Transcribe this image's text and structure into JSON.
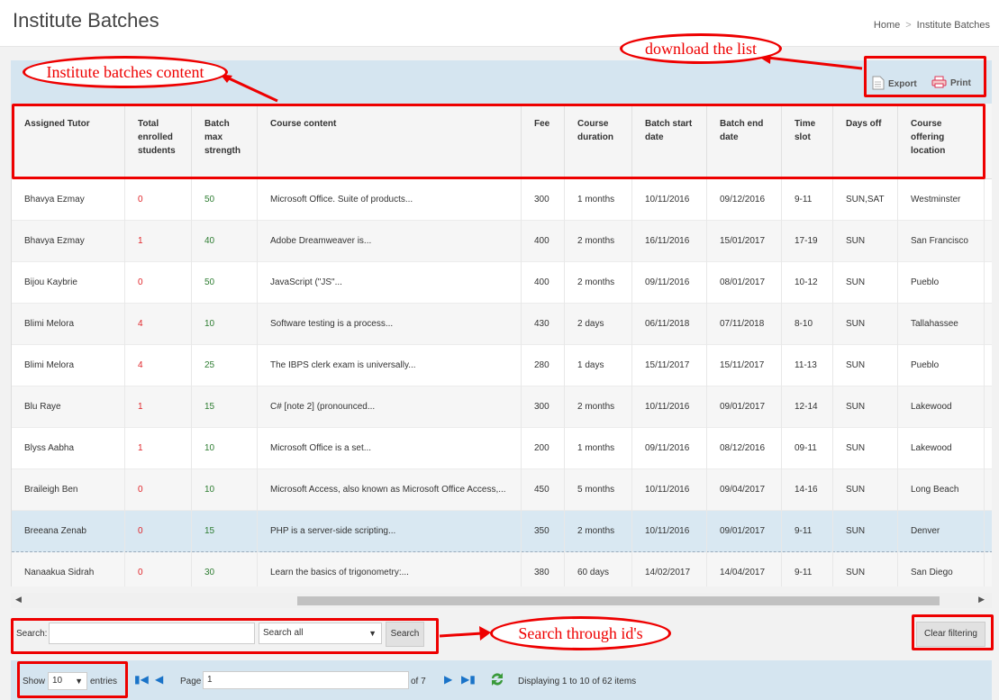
{
  "header": {
    "title": "Institute Batches",
    "breadcrumb_home": "Home",
    "breadcrumb_current": "Institute Batches"
  },
  "toolbar": {
    "export_label": "Export",
    "print_label": "Print"
  },
  "columns": [
    "Assigned Tutor",
    "Total enrolled students",
    "Batch max strength",
    "Course content",
    "Fee",
    "Course duration",
    "Batch start date",
    "Batch end date",
    "Time slot",
    "Days off",
    "Course offering location"
  ],
  "rows": [
    [
      "Bhavya Ezmay",
      "0",
      "50",
      "Microsoft Office. Suite of products...",
      "300",
      "1 months",
      "10/11/2016",
      "09/12/2016",
      "9-11",
      "SUN,SAT",
      "Westminster"
    ],
    [
      "Bhavya Ezmay",
      "1",
      "40",
      "Adobe Dreamweaver is...",
      "400",
      "2 months",
      "16/11/2016",
      "15/01/2017",
      "17-19",
      "SUN",
      "San Francisco"
    ],
    [
      "Bijou Kaybrie",
      "0",
      "50",
      "JavaScript (\"JS\"...",
      "400",
      "2 months",
      "09/11/2016",
      "08/01/2017",
      "10-12",
      "SUN",
      "Pueblo"
    ],
    [
      "Blimi Melora",
      "4",
      "10",
      "Software testing is a process...",
      "430",
      "2 days",
      "06/11/2018",
      "07/11/2018",
      "8-10",
      "SUN",
      "Tallahassee"
    ],
    [
      "Blimi Melora",
      "4",
      "25",
      "The IBPS clerk exam is universally...",
      "280",
      "1 days",
      "15/11/2017",
      "15/11/2017",
      "11-13",
      "SUN",
      "Pueblo"
    ],
    [
      "Blu Raye",
      "1",
      "15",
      "C# [note 2] (pronounced...",
      "300",
      "2 months",
      "10/11/2016",
      "09/01/2017",
      "12-14",
      "SUN",
      "Lakewood"
    ],
    [
      "Blyss Aabha",
      "1",
      "10",
      "Microsoft Office is a set...",
      "200",
      "1 months",
      "09/11/2016",
      "08/12/2016",
      "09-11",
      "SUN",
      "Lakewood"
    ],
    [
      "Braileigh Ben",
      "0",
      "10",
      "Microsoft Access, also known as Microsoft Office Access,...",
      "450",
      "5 months",
      "10/11/2016",
      "09/04/2017",
      "14-16",
      "SUN",
      "Long Beach"
    ],
    [
      "Breeana Zenab",
      "0",
      "15",
      "PHP is a server-side scripting...",
      "350",
      "2 months",
      "10/11/2016",
      "09/01/2017",
      "9-11",
      "SUN",
      "Denver"
    ],
    [
      "Nanaakua Sidrah",
      "0",
      "30",
      "Learn the basics of trigonometry:...",
      "380",
      "60 days",
      "14/02/2017",
      "14/04/2017",
      "9-11",
      "SUN",
      "San Diego"
    ]
  ],
  "search": {
    "label": "Search:",
    "value": "",
    "filter_value": "Search all",
    "button": "Search",
    "clear_button": "Clear filtering"
  },
  "pager": {
    "show_label": "Show",
    "page_size": "10",
    "entries_label": "entries",
    "page_label": "Page",
    "page_value": "1",
    "of_label": "of 7",
    "summary": "Displaying 1 to 10 of 62 items"
  },
  "annotations": {
    "content": "Institute batches content",
    "download": "download the list",
    "search": "Search through id's"
  },
  "colors": {
    "panel": "#d5e5f0",
    "annotation": "#e00000",
    "zero": "#e0252a",
    "strength": "#2e7d32"
  }
}
